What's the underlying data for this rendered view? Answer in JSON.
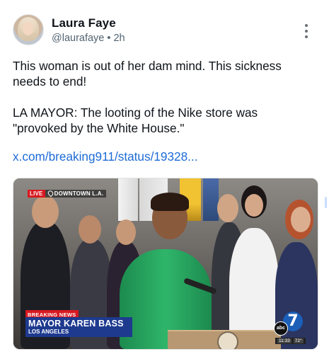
{
  "post": {
    "author_name": "Laura Faye",
    "handle": "@laurafaye",
    "separator": "•",
    "time_ago": "2h",
    "text_line1": "This woman is out of her dam mind. This sickness needs to end!",
    "text_line2": "LA MAYOR: The looting of the Nike store was \"provoked by the White House.\"",
    "link": "x.com/breaking911/status/19328..."
  },
  "media": {
    "live_label": "LIVE",
    "location_label": "DOWNTOWN L.A.",
    "breaking_label": "BREAKING NEWS",
    "chyron_title": "MAYOR KAREN BASS",
    "chyron_subtitle": "LOS ANGELES",
    "network_label": "abc",
    "channel_number": "7",
    "clock": "11:33",
    "temperature": "72°"
  },
  "icons": {
    "avatar": "user-avatar",
    "menu": "more-vertical-icon",
    "location": "location-pin-icon"
  },
  "colors": {
    "link": "#1d6bd6",
    "breaking_red": "#d71920",
    "chyron_blue": "#1e3a8f",
    "abc7_blue": "#1b5fb8"
  }
}
